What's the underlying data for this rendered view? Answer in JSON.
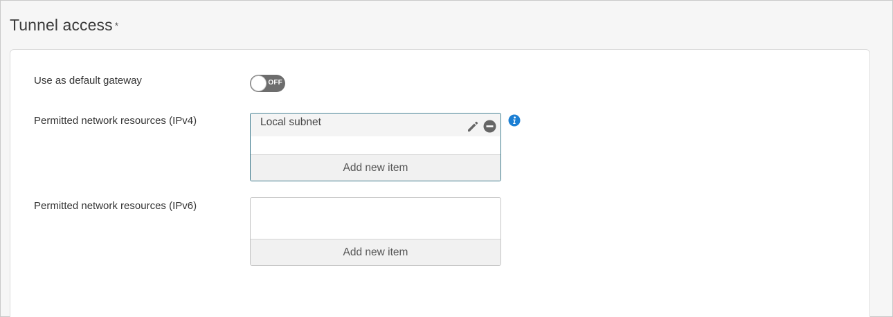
{
  "section": {
    "title": "Tunnel access",
    "required_mark": "*"
  },
  "fields": {
    "default_gateway": {
      "label": "Use as default gateway",
      "toggle_state": "OFF"
    },
    "ipv4": {
      "label": "Permitted network resources (IPv4)",
      "items": [
        "Local subnet"
      ],
      "add_label": "Add new item",
      "info_icon": "info-icon"
    },
    "ipv6": {
      "label": "Permitted network resources (IPv6)",
      "items": [],
      "add_label": "Add new item"
    }
  },
  "colors": {
    "toggle_off": "#6d6d6d",
    "active_border": "#3d7a8c",
    "info_blue": "#1b7fd4"
  }
}
